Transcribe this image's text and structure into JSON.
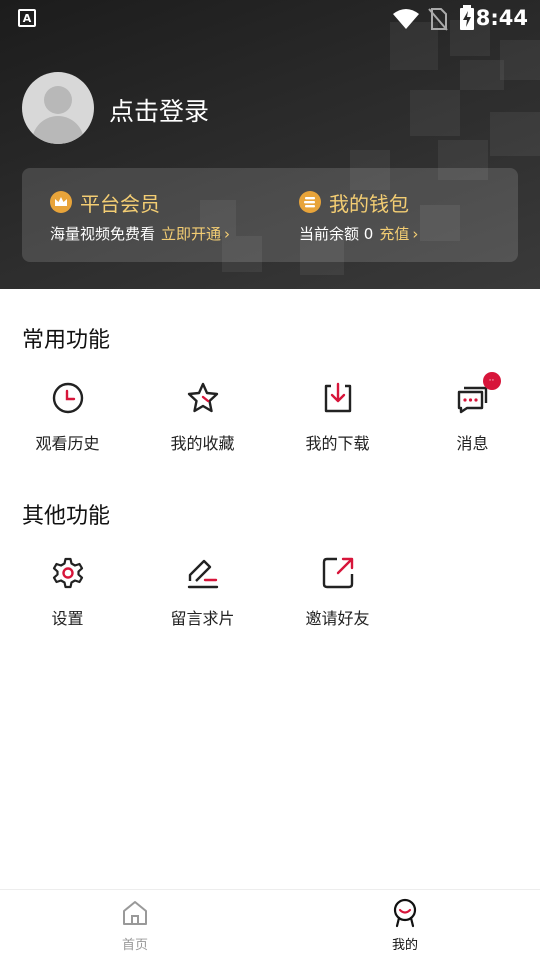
{
  "status_bar": {
    "time": "8:44",
    "app_icon_letter": "A"
  },
  "profile": {
    "login_text": "点击登录",
    "avatar_icon": "avatar-placeholder-icon"
  },
  "member_card": {
    "title": "平台会员",
    "subtitle": "海量视频免费看",
    "action": "立即开通",
    "icon": "crown-icon"
  },
  "wallet_card": {
    "title": "我的钱包",
    "subtitle": "当前余额 0",
    "action": "充值",
    "icon": "coin-icon"
  },
  "common_functions": {
    "title": "常用功能",
    "items": [
      {
        "label": "观看历史",
        "icon": "clock-icon"
      },
      {
        "label": "我的收藏",
        "icon": "star-icon"
      },
      {
        "label": "我的下载",
        "icon": "download-icon"
      },
      {
        "label": "消息",
        "icon": "message-icon",
        "badge": "··"
      }
    ]
  },
  "other_functions": {
    "title": "其他功能",
    "items": [
      {
        "label": "设置",
        "icon": "gear-icon"
      },
      {
        "label": "留言求片",
        "icon": "edit-icon"
      },
      {
        "label": "邀请好友",
        "icon": "share-icon"
      }
    ]
  },
  "bottom_nav": {
    "items": [
      {
        "label": "首页",
        "icon": "home-icon",
        "active": false
      },
      {
        "label": "我的",
        "icon": "profile-icon",
        "active": true
      }
    ]
  },
  "colors": {
    "accent": "#d7153a",
    "gold": "#f3cd73",
    "coin": "#e8a43a",
    "header_bg": "#2a2a2a"
  }
}
